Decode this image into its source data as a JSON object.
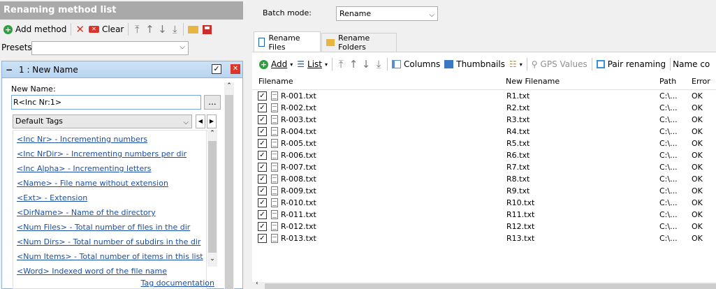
{
  "left": {
    "title": "Renaming method list",
    "toolbar": {
      "add_method": "Add method",
      "clear": "Clear"
    },
    "presets_label": "Presets:",
    "presets_value": "",
    "method": {
      "title": "1 : New Name",
      "new_name_label": "New Name:",
      "new_name_value": "R<Inc Nr:1>",
      "browse_label": "...",
      "tags_combo": "Default Tags",
      "tags": [
        "<Inc Nr> - Incrementing numbers",
        "<Inc NrDir> - Incrementing numbers per dir",
        "<Inc Alpha> - Incrementing letters",
        "<Name> - File name without extension",
        "<Ext> - Extension",
        "<DirName> - Name of the directory",
        "<Num Files> - Total number of files in the dir",
        "<Num Dirs> - Total number of subdirs in the dir",
        "<Num Items> - Total number of items in this list",
        "<Word> Indexed word of the file name"
      ],
      "tag_doc": "Tag documentation"
    }
  },
  "right": {
    "batch_label": "Batch mode:",
    "batch_value": "Rename",
    "tabs": [
      "Rename Files",
      "Rename Folders"
    ],
    "toolbar": {
      "add": "Add",
      "list": "List",
      "columns": "Columns",
      "thumbnails": "Thumbnails",
      "gps": "GPS Values",
      "pair": "Pair renaming",
      "namecol": "Name co"
    },
    "columns": [
      "Filename",
      "New Filename",
      "Path",
      "Error"
    ],
    "rows": [
      [
        "R-001.txt",
        "R1.txt",
        "C:\\...",
        "OK"
      ],
      [
        "R-002.txt",
        "R2.txt",
        "C:\\...",
        "OK"
      ],
      [
        "R-003.txt",
        "R3.txt",
        "C:\\...",
        "OK"
      ],
      [
        "R-004.txt",
        "R4.txt",
        "C:\\...",
        "OK"
      ],
      [
        "R-005.txt",
        "R5.txt",
        "C:\\...",
        "OK"
      ],
      [
        "R-006.txt",
        "R6.txt",
        "C:\\...",
        "OK"
      ],
      [
        "R-007.txt",
        "R7.txt",
        "C:\\...",
        "OK"
      ],
      [
        "R-008.txt",
        "R8.txt",
        "C:\\...",
        "OK"
      ],
      [
        "R-009.txt",
        "R9.txt",
        "C:\\...",
        "OK"
      ],
      [
        "R-010.txt",
        "R10.txt",
        "C:\\...",
        "OK"
      ],
      [
        "R-011.txt",
        "R11.txt",
        "C:\\...",
        "OK"
      ],
      [
        "R-012.txt",
        "R12.txt",
        "C:\\...",
        "OK"
      ],
      [
        "R-013.txt",
        "R13.txt",
        "C:\\...",
        "OK"
      ]
    ]
  },
  "colors": {
    "accent": "#2e9e3e",
    "close": "#d9352b",
    "link": "#1a4fa3",
    "method_header": "#cfe3f7"
  }
}
